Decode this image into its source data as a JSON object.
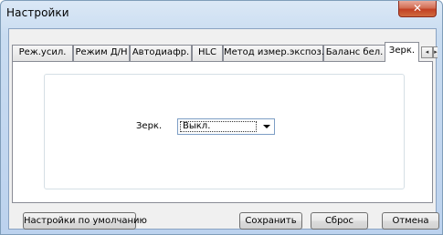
{
  "window": {
    "title": "Настройки",
    "close_glyph": "✕"
  },
  "tabs": [
    {
      "label": "Реж.усил."
    },
    {
      "label": "Режим Д/Н"
    },
    {
      "label": "Автодиафр."
    },
    {
      "label": "HLC"
    },
    {
      "label": "Метод измер.экспоз."
    },
    {
      "label": "Баланс бел."
    },
    {
      "label": "Зерк.",
      "active": true
    }
  ],
  "tab_scroll": {
    "left": "◂",
    "right": "▸"
  },
  "mirror": {
    "label": "Зерк.",
    "selected": "Выкл."
  },
  "buttons": {
    "defaults": "Настройки по умолчанию",
    "save": "Сохранить",
    "reset": "Сброс",
    "cancel": "Отмена"
  }
}
